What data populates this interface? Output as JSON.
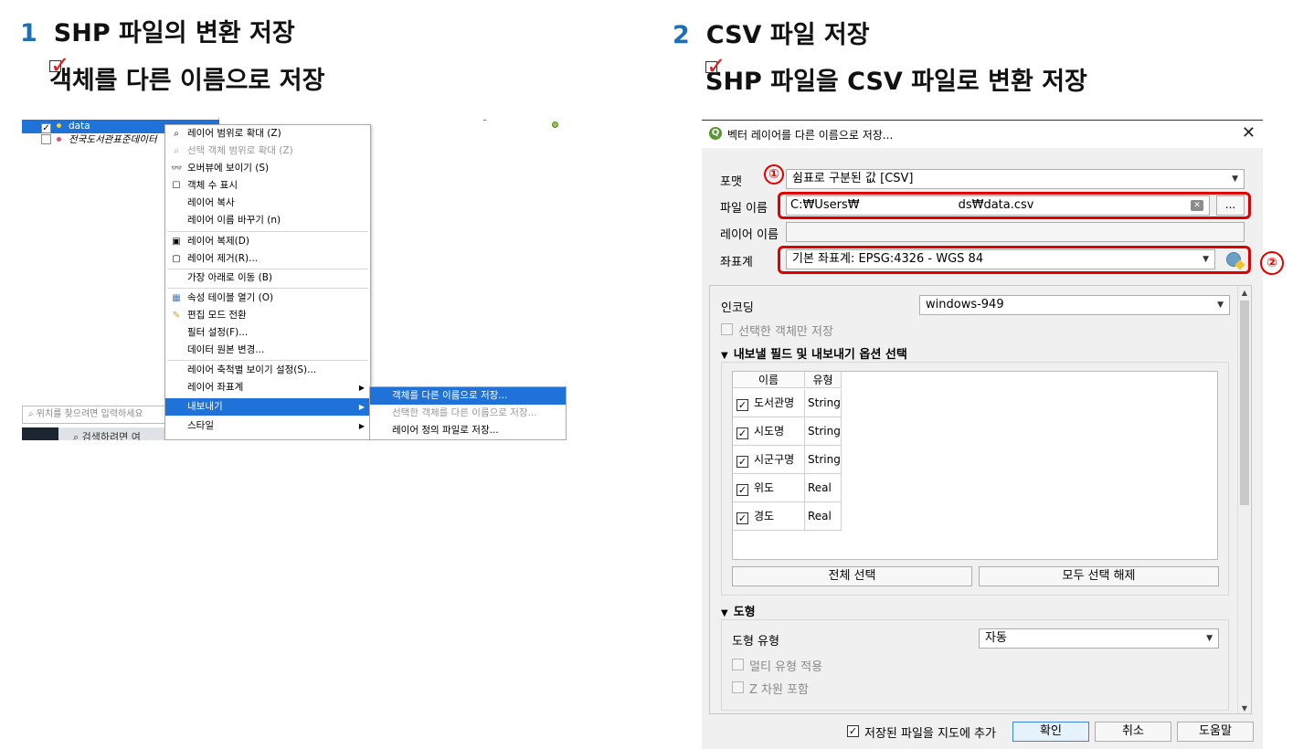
{
  "left_section": {
    "number": "1",
    "title": "SHP 파일의 변환 저장",
    "check": "✓",
    "subtitle": "객체를 다른 이름으로 저장"
  },
  "right_section": {
    "number": "2",
    "title": "CSV 파일 저장",
    "check": "✓",
    "subtitle": "SHP 파일을 CSV 파일로 변환 저장"
  },
  "layers_panel": {
    "layers": [
      {
        "name": "data",
        "checked": true,
        "selected": true
      },
      {
        "name": "전국도서관표준데이터",
        "checked": false,
        "selected": false
      }
    ],
    "search_placeholder": "위치를 찾으려면 입력하세요",
    "taskbar_text": "검색하려면 여"
  },
  "context_menu": {
    "items": [
      {
        "label": "레이어 범위로 확대 (Z)",
        "icon": "zoom-icon",
        "glyph": "⌕",
        "disabled": false
      },
      {
        "label": "선택 객체 범위로 확대 (Z)",
        "icon": "zoom-selection-icon",
        "glyph": "⌕",
        "disabled": true
      },
      {
        "label": "오버뷰에 보이기 (S)",
        "icon": "overview-icon",
        "glyph": "👓",
        "disabled": false
      },
      {
        "label": "객체 수 표시",
        "icon": "checkbox-icon",
        "glyph": "☐",
        "disabled": false
      },
      {
        "label": "레이어 복사",
        "icon": "",
        "glyph": "",
        "disabled": false
      },
      {
        "label": "레이어 이름 바꾸기 (n)",
        "icon": "",
        "glyph": "",
        "disabled": false
      },
      {
        "label": "레이어 복제(D)",
        "icon": "duplicate-icon",
        "glyph": "▣",
        "disabled": false
      },
      {
        "label": "레이어 제거(R)...",
        "icon": "remove-icon",
        "glyph": "▢",
        "disabled": false
      },
      {
        "label": "가장 아래로 이동 (B)",
        "icon": "",
        "glyph": "",
        "disabled": false
      },
      {
        "label": "속성 테이블 열기 (O)",
        "icon": "table-icon",
        "glyph": "▦",
        "disabled": false
      },
      {
        "label": "편집 모드 전환",
        "icon": "pencil-icon",
        "glyph": "✎",
        "disabled": false
      },
      {
        "label": "필터 설정(F)...",
        "icon": "",
        "glyph": "",
        "disabled": false
      },
      {
        "label": "데이터 원본 변경...",
        "icon": "",
        "glyph": "",
        "disabled": false
      },
      {
        "label": "레이어 축척별 보이기 설정(S)...",
        "icon": "",
        "glyph": "",
        "disabled": false
      },
      {
        "label": "레이어 좌표계",
        "icon": "",
        "glyph": "",
        "disabled": false,
        "submenu": true
      },
      {
        "label": "내보내기",
        "icon": "",
        "glyph": "",
        "disabled": false,
        "submenu": true,
        "highlighted": true
      },
      {
        "label": "스타일",
        "icon": "",
        "glyph": "",
        "disabled": false,
        "submenu": true
      }
    ],
    "submenu": [
      {
        "label": "객체를 다른 이름으로 저장...",
        "highlighted": true,
        "disabled": false
      },
      {
        "label": "선택한 객체를 다른 이름으로 저장...",
        "highlighted": false,
        "disabled": true
      },
      {
        "label": "레이어 정의 파일로 저장...",
        "highlighted": false,
        "disabled": false
      }
    ]
  },
  "dialog": {
    "title": "벡터 레이어를 다른 이름으로 저장...",
    "close": "✕",
    "format_label": "포맷",
    "format_value": "쉼표로 구분된 값 [CSV]",
    "filename_label": "파일 이름",
    "filename_value_start": "C:₩Users₩",
    "filename_value_end": "ds₩data.csv",
    "browse_label": "...",
    "layername_label": "레이어 이름",
    "layername_value": "",
    "crs_label": "좌표계",
    "crs_value": "기본 좌표계: EPSG:4326 - WGS 84",
    "marker1": "①",
    "marker2": "②",
    "encoding_label": "인코딩",
    "encoding_value": "windows-949",
    "selected_only_label": "선택한 객체만 저장",
    "fields_section": "내보낼 필드 및 내보내기 옵션 선택",
    "table_headers": [
      "이름",
      "유형"
    ],
    "fields": [
      {
        "name": "도서관명",
        "type": "String",
        "checked": true
      },
      {
        "name": "시도명",
        "type": "String",
        "checked": true
      },
      {
        "name": "시군구명",
        "type": "String",
        "checked": true
      },
      {
        "name": "위도",
        "type": "Real",
        "checked": true
      },
      {
        "name": "경도",
        "type": "Real",
        "checked": true
      }
    ],
    "select_all": "전체 선택",
    "deselect_all": "모두 선택 해제",
    "geometry_section": "도형",
    "geometry_type_label": "도형 유형",
    "geometry_type_value": "자동",
    "multi_type_label": "멀티 유형 적용",
    "z_dim_label": "Z 차원 포함",
    "add_to_map_label": "저장된 파일을 지도에 추가",
    "ok": "확인",
    "cancel": "취소",
    "help": "도움말"
  },
  "colors": {
    "heading_number": "#1f6fb5",
    "check_mark": "#e02020",
    "highlight": "#1f73d8",
    "annotation_red": "#e00000"
  }
}
